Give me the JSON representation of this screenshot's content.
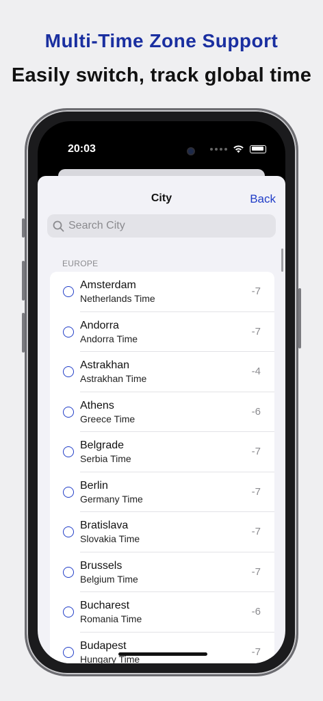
{
  "promo": {
    "headline": "Multi-Time Zone Support",
    "subline": "Easily switch, track global time"
  },
  "status_bar": {
    "time": "20:03",
    "icons": [
      "camera-dot",
      "signal-dots-icon",
      "wifi-icon",
      "battery-icon"
    ]
  },
  "nav": {
    "title": "City",
    "back_label": "Back"
  },
  "search": {
    "placeholder": "Search City",
    "value": ""
  },
  "section": {
    "header": "EUROPE"
  },
  "cities": [
    {
      "city": "Amsterdam",
      "zone": "Netherlands Time",
      "offset": "-7"
    },
    {
      "city": "Andorra",
      "zone": "Andorra Time",
      "offset": "-7"
    },
    {
      "city": "Astrakhan",
      "zone": "Astrakhan Time",
      "offset": "-4"
    },
    {
      "city": "Athens",
      "zone": "Greece Time",
      "offset": "-6"
    },
    {
      "city": "Belgrade",
      "zone": "Serbia Time",
      "offset": "-7"
    },
    {
      "city": "Berlin",
      "zone": "Germany Time",
      "offset": "-7"
    },
    {
      "city": "Bratislava",
      "zone": "Slovakia Time",
      "offset": "-7"
    },
    {
      "city": "Brussels",
      "zone": "Belgium Time",
      "offset": "-7"
    },
    {
      "city": "Bucharest",
      "zone": "Romania Time",
      "offset": "-6"
    },
    {
      "city": "Budapest",
      "zone": "Hungary Time",
      "offset": "-7"
    }
  ],
  "colors": {
    "accent": "#1f3cc7",
    "headline": "#1a2fa0",
    "background": "#efeff1"
  }
}
